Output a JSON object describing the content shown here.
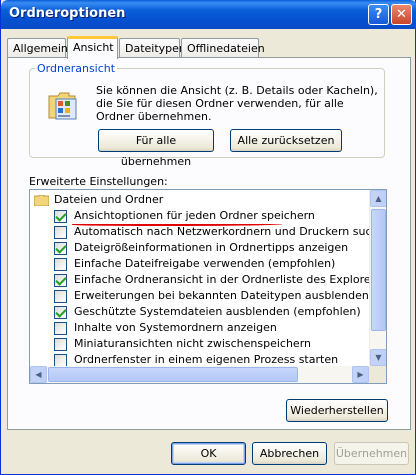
{
  "window": {
    "title": "Ordneroptionen",
    "help_glyph": "?",
    "close_glyph": "✕"
  },
  "tabs": [
    {
      "label": "Allgemein",
      "active": false
    },
    {
      "label": "Ansicht",
      "active": true
    },
    {
      "label": "Dateitypen",
      "active": false
    },
    {
      "label": "Offlinedateien",
      "active": false
    }
  ],
  "folder_view": {
    "legend": "Ordneransicht",
    "icon": "folder-view-icon",
    "description": "Sie können die Ansicht (z. B. Details oder Kacheln), die Sie für diesen Ordner verwenden, für alle Ordner übernehmen.",
    "apply_all_label": "Für alle übernehmen",
    "reset_all_label": "Alle zurücksetzen"
  },
  "advanced": {
    "label": "Erweiterte Einstellungen:",
    "root_label": "Dateien und Ordner",
    "root_icon": "folder-icon",
    "items": [
      {
        "label": "Ansichtoptionen für jeden Ordner speichern",
        "checked": true
      },
      {
        "label": "Automatisch nach Netzwerkordnern und Druckern suchen",
        "checked": false
      },
      {
        "label": "Dateigrößeinformationen in Ordnertipps anzeigen",
        "checked": true
      },
      {
        "label": "Einfache Dateifreigabe verwenden (empfohlen)",
        "checked": false
      },
      {
        "label": "Einfache Ordneransicht in der Ordnerliste des Explorers anzeigen",
        "checked": true
      },
      {
        "label": "Erweiterungen bei bekannten Dateitypen ausblenden",
        "checked": false
      },
      {
        "label": "Geschützte Systemdateien ausblenden (empfohlen)",
        "checked": true
      },
      {
        "label": "Inhalte von Systemordnern anzeigen",
        "checked": false
      },
      {
        "label": "Miniaturansichten nicht zwischenspeichern",
        "checked": false
      },
      {
        "label": "Ordnerfenster in einem eigenen Prozess starten",
        "checked": false
      }
    ],
    "restore_label": "Wiederherstellen",
    "scroll_up_glyph": "▲",
    "scroll_down_glyph": "▼",
    "scroll_left_glyph": "◀",
    "scroll_right_glyph": "▶"
  },
  "footer": {
    "ok_label": "OK",
    "cancel_label": "Abbrechen",
    "apply_label": "Übernehmen"
  },
  "colors": {
    "title_bar": "#0a5fd7",
    "highlight_underline": "#e00000",
    "checkmark": "#21a121"
  }
}
